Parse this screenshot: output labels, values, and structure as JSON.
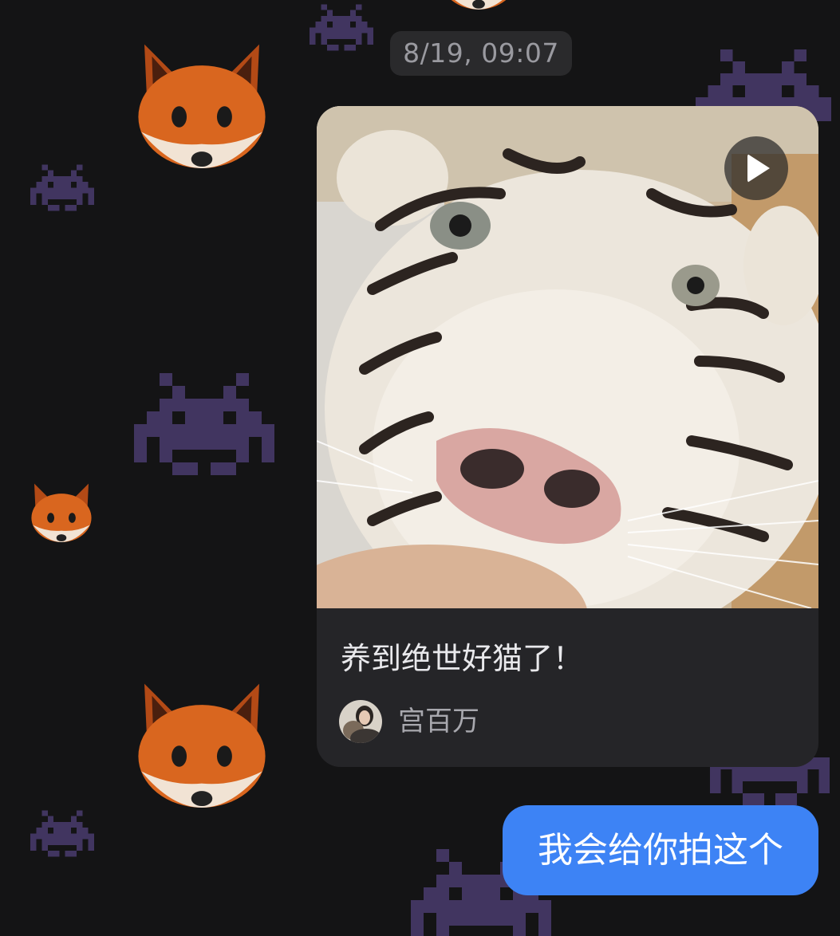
{
  "conversation": {
    "timestamp": "8/19, 09:07",
    "shared_video": {
      "caption": "养到绝世好猫了！",
      "author": "宫百万",
      "thumbnail": "white-tiger-closeup",
      "play_icon": "play-icon"
    },
    "outgoing_message": "我会给你拍这个"
  },
  "wallpaper": {
    "icons": [
      "fox-emoji",
      "space-invader"
    ]
  },
  "colors": {
    "background": "#141415",
    "bubble_out": "#3d83f5",
    "card": "#252528",
    "timestamp_bg": "#2a2a2c"
  }
}
